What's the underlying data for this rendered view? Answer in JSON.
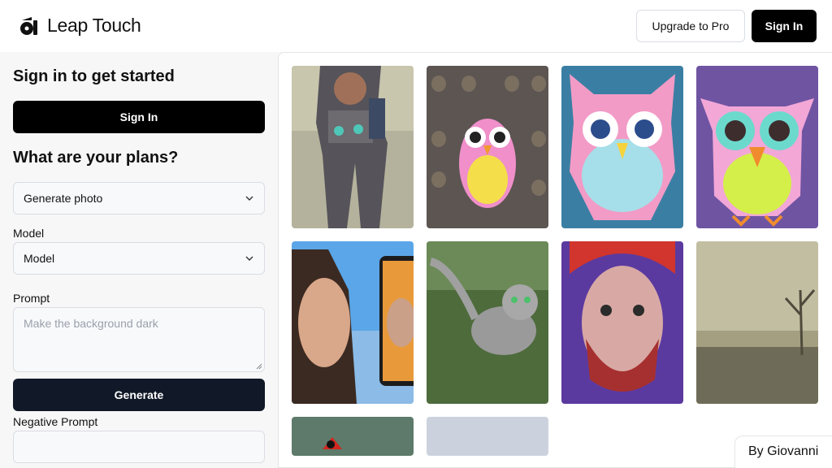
{
  "header": {
    "brand": "Leap Touch",
    "upgrade_label": "Upgrade to Pro",
    "signin_label": "Sign In"
  },
  "sidebar": {
    "signin_heading": "Sign in to get started",
    "signin_button": "Sign In",
    "plans_heading": "What are your plans?",
    "plan_select_value": "Generate photo",
    "model_label": "Model",
    "model_select_value": "Model",
    "prompt_label": "Prompt",
    "prompt_placeholder": "Make the background dark",
    "generate_button": "Generate",
    "negative_prompt_label": "Negative Prompt",
    "negative_prompt_value": ""
  },
  "gallery": {
    "images": [
      "armored female cyborg",
      "colorful owl on owl pattern",
      "pink patterned owl",
      "owl on purple background",
      "woman beside phone screen",
      "leaping grey cat",
      "red-haired bearded man portrait",
      "misty river with tree",
      "red bird on green",
      "grey-blue partial image"
    ]
  },
  "footer": {
    "credit": "By Giovanni"
  },
  "colors": {
    "primary_black": "#000000",
    "generate_navy": "#111827",
    "page_bg": "#f7f7f8"
  }
}
